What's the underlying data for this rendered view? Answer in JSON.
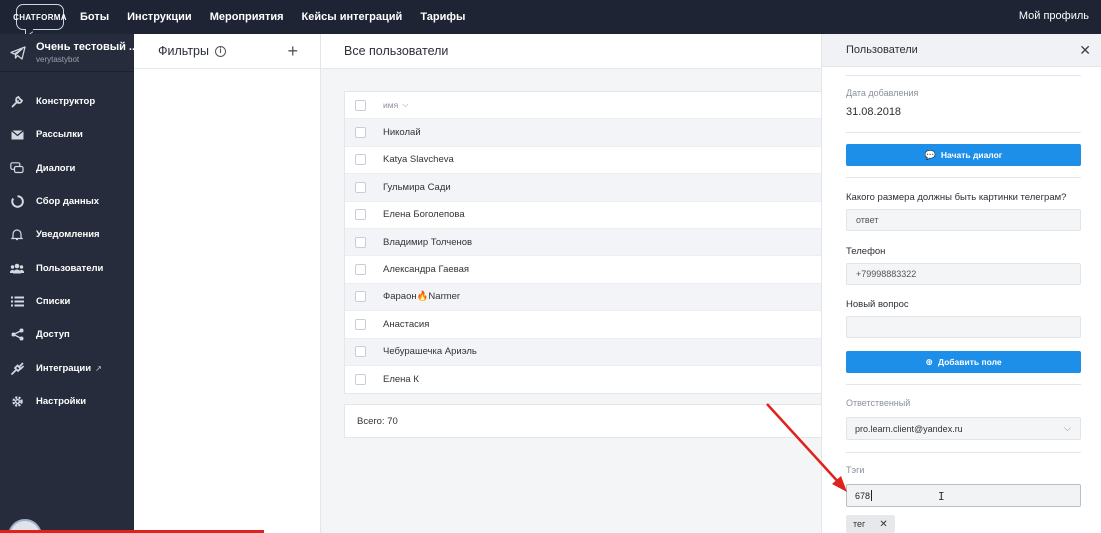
{
  "topbar": {
    "logo": "CHATFORMA",
    "nav": [
      "Боты",
      "Инструкции",
      "Мероприятия",
      "Кейсы интеграций",
      "Тарифы"
    ],
    "profile": "Мой профиль"
  },
  "sidebar": {
    "bot_name": "Очень тестовый ...",
    "bot_handle": "verytastybot",
    "items": [
      {
        "label": "Конструктор",
        "icon": "wrench-icon"
      },
      {
        "label": "Рассылки",
        "icon": "mail-icon"
      },
      {
        "label": "Диалоги",
        "icon": "chat-icon"
      },
      {
        "label": "Сбор данных",
        "icon": "circle-icon"
      },
      {
        "label": "Уведомления",
        "icon": "bell-icon"
      },
      {
        "label": "Пользователи",
        "icon": "users-icon"
      },
      {
        "label": "Списки",
        "icon": "list-icon"
      },
      {
        "label": "Доступ",
        "icon": "share-icon"
      },
      {
        "label": "Интеграции",
        "icon": "plug-icon"
      },
      {
        "label": "Настройки",
        "icon": "gear-icon"
      }
    ]
  },
  "filters": {
    "title": "Фильтры"
  },
  "main": {
    "title": "Все пользователи",
    "column_header": "имя",
    "rows": [
      "Николай",
      "Katya Slavcheva",
      "Гульмира Сади",
      "Елена Боголепова",
      "Владимир Толченов",
      "Александра Гаевая",
      "Фараон🔥Narmer",
      "Анастасия",
      "Чебурашечка Ариэль",
      "Елена К"
    ],
    "total": "Всего: 70"
  },
  "panel": {
    "title": "Пользователи",
    "date_label": "Дата добавления",
    "date_value": "31.08.2018",
    "start_dialog": "Начать диалог",
    "q1_label": "Какого размера должны быть картинки телеграм?",
    "q1_value": "ответ",
    "phone_label": "Телефон",
    "phone_value": "+79998883322",
    "q2_label": "Новый вопрос",
    "q2_value": "",
    "add_field": "Добавить поле",
    "responsible_label": "Ответственный",
    "responsible_value": "pro.learn.client@yandex.ru",
    "tags_label": "Тэги",
    "tags_input": "678",
    "tags": [
      "тег"
    ]
  },
  "video_progress": 0.24,
  "colors": {
    "accent": "#1e8fe8",
    "nav": "#1e2433",
    "sidebar": "#262c3b",
    "annotation": "#e0221c"
  }
}
